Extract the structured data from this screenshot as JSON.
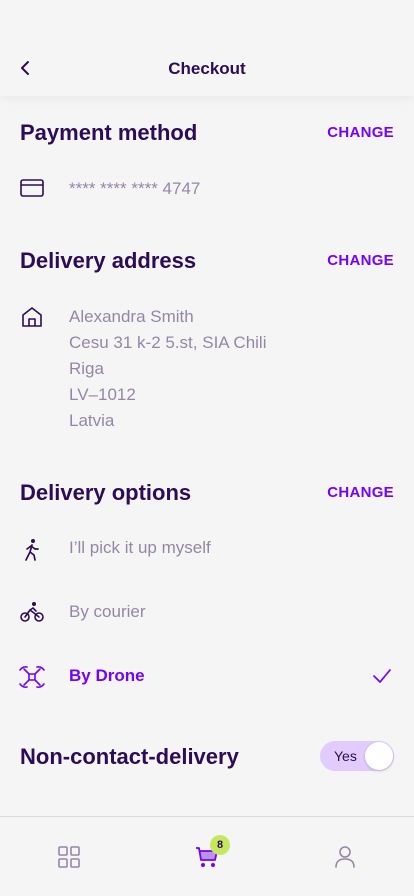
{
  "header": {
    "title": "Checkout",
    "back_icon": "chevron-left-icon"
  },
  "payment": {
    "title": "Payment method",
    "change_label": "CHANGE",
    "card_icon": "credit-card-icon",
    "card_number": "**** **** **** 4747"
  },
  "delivery_address": {
    "title": "Delivery address",
    "change_label": "CHANGE",
    "icon": "home-icon",
    "lines": [
      "Alexandra Smith",
      "Cesu 31 k-2 5.st, SIA Chili",
      "Riga",
      "LV–1012",
      "Latvia"
    ]
  },
  "delivery_options": {
    "title": "Delivery options",
    "change_label": "CHANGE",
    "options": [
      {
        "label": "I’ll pick it up myself",
        "icon": "walking-person-icon",
        "selected": false
      },
      {
        "label": "By courier",
        "icon": "bicycle-icon",
        "selected": false
      },
      {
        "label": "By Drone",
        "icon": "drone-icon",
        "selected": true
      }
    ]
  },
  "non_contact": {
    "title": "Non-contact-delivery",
    "toggle_label": "Yes",
    "enabled": true
  },
  "tabbar": {
    "items": [
      {
        "icon": "grid-icon",
        "active": false
      },
      {
        "icon": "cart-icon",
        "active": true,
        "badge": "8"
      },
      {
        "icon": "person-icon",
        "active": false
      }
    ]
  },
  "colors": {
    "accent": "#7203ff",
    "primary_text": "#2d0c57",
    "muted_text": "#9586a8",
    "badge": "#c5e85e",
    "toggle_bg": "#e2cbff"
  }
}
